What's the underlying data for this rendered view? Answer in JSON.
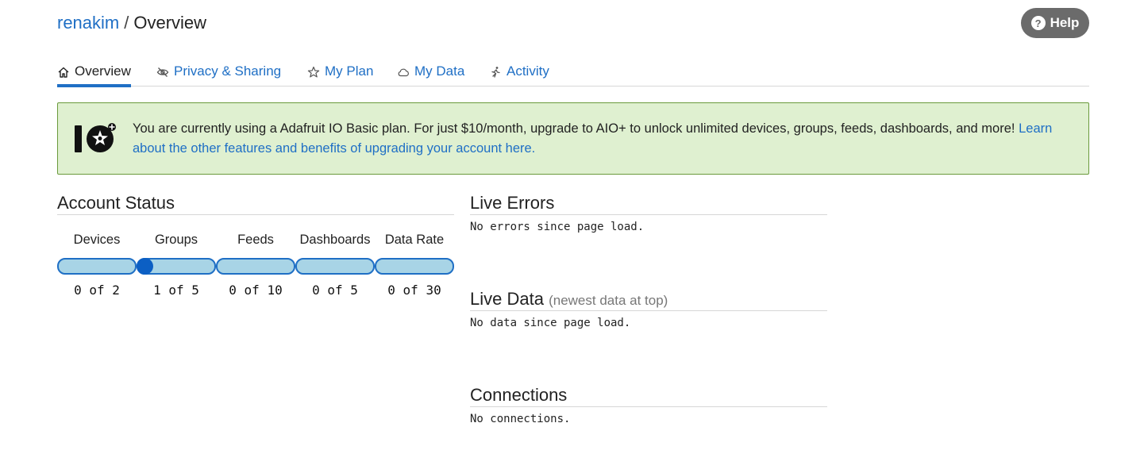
{
  "breadcrumb": {
    "user": "renakim",
    "separator": "/",
    "page": "Overview"
  },
  "help": {
    "label": "Help",
    "icon": "question-circle-icon"
  },
  "tabs": [
    {
      "label": "Overview",
      "icon": "home-icon",
      "active": true
    },
    {
      "label": "Privacy & Sharing",
      "icon": "eye-slash-icon"
    },
    {
      "label": "My Plan",
      "icon": "star-icon"
    },
    {
      "label": "My Data",
      "icon": "cloud-icon"
    },
    {
      "label": "Activity",
      "icon": "running-person-icon"
    }
  ],
  "banner": {
    "text": "You are currently using a Adafruit IO Basic plan. For just $10/month, upgrade to AIO+ to unlock unlimited devices, groups, feeds, dashboards, and more!",
    "link": "Learn about the other features and benefits of upgrading your account here.",
    "logo_text": "IO"
  },
  "account_status": {
    "title": "Account Status",
    "meters": [
      {
        "label": "Devices",
        "value": "0 of 2",
        "used": 0,
        "limit": 2
      },
      {
        "label": "Groups",
        "value": "1 of 5",
        "used": 1,
        "limit": 5
      },
      {
        "label": "Feeds",
        "value": "0 of 10",
        "used": 0,
        "limit": 10
      },
      {
        "label": "Dashboards",
        "value": "0 of 5",
        "used": 0,
        "limit": 5
      },
      {
        "label": "Data Rate",
        "value": "0 of 30",
        "used": 0,
        "limit": 30
      }
    ]
  },
  "live_errors": {
    "title": "Live Errors",
    "message": "No errors since page load."
  },
  "live_data": {
    "title": "Live Data",
    "subtitle": "(newest data at top)",
    "message": "No data since page load."
  },
  "connections": {
    "title": "Connections",
    "message": "No connections."
  },
  "colors": {
    "link": "#1f6fc5",
    "banner_bg": "#dff0d0",
    "banner_border": "#6a9a3c",
    "meter_fill": "#a8d4e6",
    "meter_knob": "#0c5fc4"
  }
}
